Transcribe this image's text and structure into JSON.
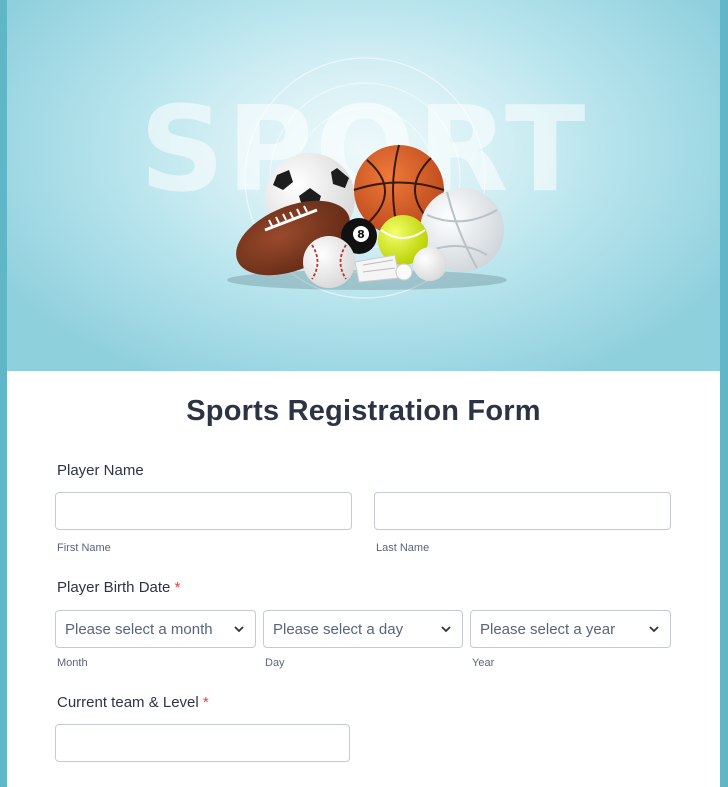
{
  "hero": {
    "title": "SPORT"
  },
  "form": {
    "title": "Sports Registration Form",
    "player_name": {
      "label": "Player Name",
      "first_sublabel": "First Name",
      "last_sublabel": "Last Name",
      "first_value": "",
      "last_value": ""
    },
    "birth_date": {
      "label": "Player Birth Date",
      "required_mark": "*",
      "month_placeholder": "Please select a month",
      "day_placeholder": "Please select a day",
      "year_placeholder": "Please select a year",
      "month_sublabel": "Month",
      "day_sublabel": "Day",
      "year_sublabel": "Year"
    },
    "team_level": {
      "label": "Current team & Level",
      "required_mark": "*",
      "value": ""
    }
  },
  "colors": {
    "accent_required": "#f23a3c",
    "text": "#2c3345",
    "border": "#c3cad8"
  }
}
